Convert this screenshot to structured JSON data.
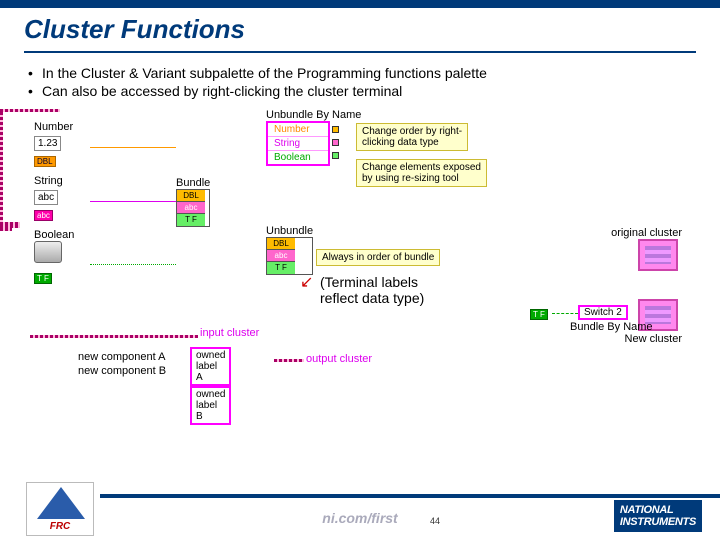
{
  "title": "Cluster Functions",
  "bullets": [
    "In the Cluster & Variant subpalette of the Programming  functions palette",
    "Can also be accessed by right-clicking the cluster terminal"
  ],
  "left": {
    "number_label": "Number",
    "number_value": "1.23",
    "dbl": "DBL",
    "string_label": "String",
    "string_value": "abc",
    "abc": "abc",
    "boolean_label": "Boolean",
    "tf": "T F"
  },
  "bundle": {
    "label": "Bundle"
  },
  "ubn": {
    "label": "Unbundle By Name",
    "rows": [
      "Number",
      "String",
      "Boolean"
    ]
  },
  "notes": {
    "n1": "Change order by right-\nclicking data type",
    "n2": "Change elements exposed\nby using re-sizing tool",
    "n3": "Always in order of bundle"
  },
  "ub": {
    "label": "Unbundle"
  },
  "annotation": "(Terminal labels\nreflect data type)",
  "bbn": {
    "input_cluster": "input cluster",
    "compA": "new component A",
    "compB": "new component B",
    "ownedA": "owned label A",
    "ownedB": "owned label B",
    "output_cluster": "output cluster"
  },
  "right": {
    "orig": "original cluster",
    "switch2": "Switch 2",
    "bbn_label": "Bundle By Name",
    "new_cluster": "New cluster",
    "tf": "T F"
  },
  "footer": {
    "url": "ni.com/first",
    "page": "44",
    "frc": "FRC",
    "ni": "NATIONAL\nINSTRUMENTS"
  }
}
